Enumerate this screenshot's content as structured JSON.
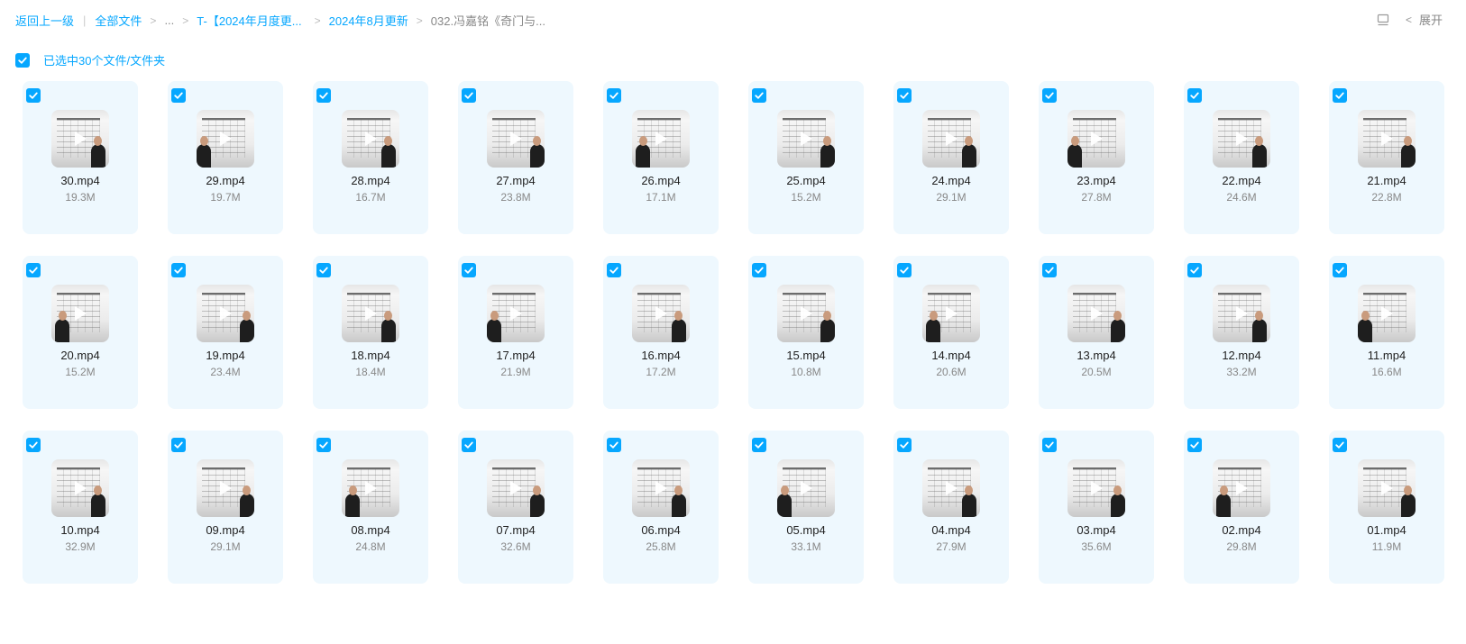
{
  "breadcrumb": {
    "back": "返回上一级",
    "all_files": "全部文件",
    "ellipsis": "...",
    "folder1": "T-【2024年月度更...",
    "folder2": "2024年8月更新",
    "current": "032.冯嘉铭《奇门与..."
  },
  "toolbar": {
    "view_toggle_icon": "list-view-icon",
    "expand_label": "展开"
  },
  "selection": {
    "label": "已选中30个文件/文件夹"
  },
  "files": [
    {
      "name": "30.mp4",
      "size": "19.3M"
    },
    {
      "name": "29.mp4",
      "size": "19.7M"
    },
    {
      "name": "28.mp4",
      "size": "16.7M"
    },
    {
      "name": "27.mp4",
      "size": "23.8M"
    },
    {
      "name": "26.mp4",
      "size": "17.1M"
    },
    {
      "name": "25.mp4",
      "size": "15.2M"
    },
    {
      "name": "24.mp4",
      "size": "29.1M"
    },
    {
      "name": "23.mp4",
      "size": "27.8M"
    },
    {
      "name": "22.mp4",
      "size": "24.6M"
    },
    {
      "name": "21.mp4",
      "size": "22.8M"
    },
    {
      "name": "20.mp4",
      "size": "15.2M"
    },
    {
      "name": "19.mp4",
      "size": "23.4M"
    },
    {
      "name": "18.mp4",
      "size": "18.4M"
    },
    {
      "name": "17.mp4",
      "size": "21.9M"
    },
    {
      "name": "16.mp4",
      "size": "17.2M"
    },
    {
      "name": "15.mp4",
      "size": "10.8M"
    },
    {
      "name": "14.mp4",
      "size": "20.6M"
    },
    {
      "name": "13.mp4",
      "size": "20.5M"
    },
    {
      "name": "12.mp4",
      "size": "33.2M"
    },
    {
      "name": "11.mp4",
      "size": "16.6M"
    },
    {
      "name": "10.mp4",
      "size": "32.9M"
    },
    {
      "name": "09.mp4",
      "size": "29.1M"
    },
    {
      "name": "08.mp4",
      "size": "24.8M"
    },
    {
      "name": "07.mp4",
      "size": "32.6M"
    },
    {
      "name": "06.mp4",
      "size": "25.8M"
    },
    {
      "name": "05.mp4",
      "size": "33.1M"
    },
    {
      "name": "04.mp4",
      "size": "27.9M"
    },
    {
      "name": "03.mp4",
      "size": "35.6M"
    },
    {
      "name": "02.mp4",
      "size": "29.8M"
    },
    {
      "name": "01.mp4",
      "size": "11.9M"
    }
  ],
  "colors": {
    "accent": "#06a7ff",
    "tile_bg": "#eef8fe"
  }
}
